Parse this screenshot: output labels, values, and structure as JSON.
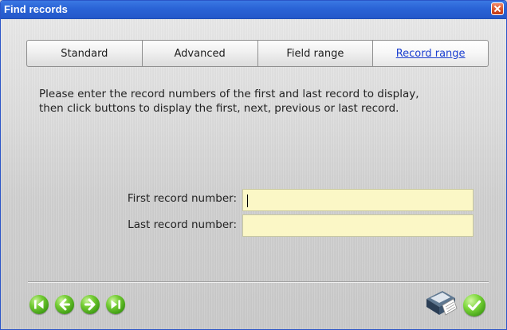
{
  "window": {
    "title": "Find records"
  },
  "tabs": [
    {
      "label": "Standard",
      "active": false
    },
    {
      "label": "Advanced",
      "active": false
    },
    {
      "label": "Field range",
      "active": false
    },
    {
      "label": "Record range",
      "active": true
    }
  ],
  "instructions": "Please enter the record numbers of the first and last record to display,\nthen click buttons to display the first, next, previous or last record.",
  "form": {
    "first_label": "First record number:",
    "first_value": "",
    "last_label": "Last record number:",
    "last_value": ""
  },
  "icons": {
    "nav": [
      "first-record-icon",
      "previous-record-icon",
      "next-record-icon",
      "last-record-icon"
    ],
    "printer": "printer-icon",
    "ok": "checkmark-icon"
  },
  "colors": {
    "titlebar": "#2a63d6",
    "field_bg": "#fbf7c6",
    "active_tab_text": "#1b3fd0",
    "button_green": "#4fb21c"
  }
}
